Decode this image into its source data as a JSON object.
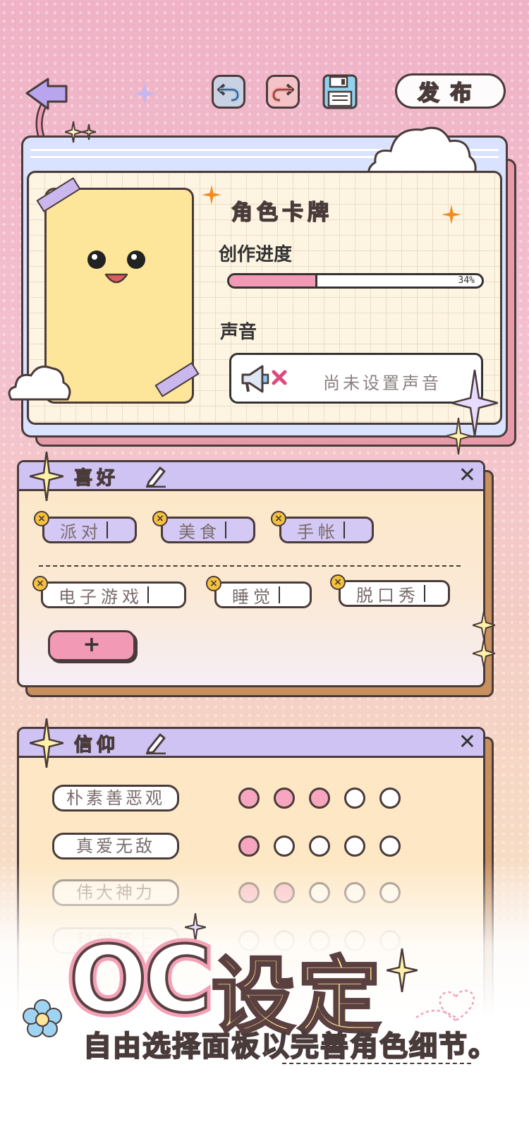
{
  "toolbar": {
    "undo_icon": "undo-icon",
    "redo_icon": "redo-icon",
    "save_icon": "save-icon",
    "publish_label": "发布"
  },
  "card": {
    "title": "角色卡牌",
    "progress_label": "创作进度",
    "progress_percent": 34,
    "progress_text": "34%",
    "sound_label": "声音",
    "sound_value": "尚未设置声音"
  },
  "hobbies": {
    "title": "喜好",
    "tags": [
      "派对",
      "美食",
      "手帐",
      "电子游戏",
      "睡觉",
      "脱口秀"
    ],
    "add_label": "+"
  },
  "beliefs": {
    "title": "信仰",
    "items": [
      {
        "label": "朴素善恶观",
        "level": 3
      },
      {
        "label": "真爱无敌",
        "level": 1
      },
      {
        "label": "伟大神力",
        "level": 2
      },
      {
        "label": "科学至上",
        "level": 0
      }
    ]
  },
  "promo": {
    "headline_oc": "OC",
    "headline_rest": "设定",
    "subtitle": "自由选择面板以完善角色细节。"
  },
  "colors": {
    "accent_pink": "#f29ab5",
    "accent_purple": "#cfc3f3",
    "title_orange": "#f5a623",
    "card_yellow": "#fde59a"
  }
}
